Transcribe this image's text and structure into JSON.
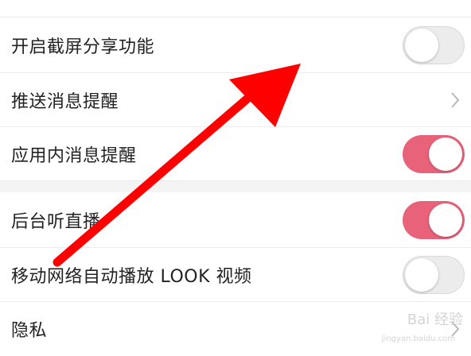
{
  "settings": {
    "items": [
      {
        "label": "开启截屏分享功能",
        "control": "toggle",
        "on": false
      },
      {
        "label": "推送消息提醒",
        "control": "chevron"
      },
      {
        "label": "应用内消息提醒",
        "control": "toggle",
        "on": true
      },
      {
        "label": "后台听直播",
        "control": "toggle",
        "on": true
      },
      {
        "label": "移动网络自动播放 LOOK 视频",
        "control": "toggle",
        "on": false
      },
      {
        "label": "隐私",
        "control": "chevron"
      }
    ]
  },
  "colors": {
    "toggle_on": "#e8627a",
    "toggle_off": "#ececec",
    "annotation_arrow": "#ff0000"
  },
  "icons": {
    "chevron": "chevron-right-icon"
  },
  "annotation": {
    "type": "red-arrow-pointing-up-right"
  },
  "watermark": {
    "text": "Bai 经验",
    "sub": "jingyan.baidu.com"
  }
}
